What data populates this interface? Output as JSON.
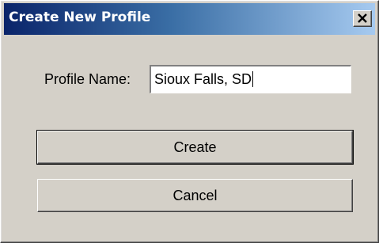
{
  "window": {
    "title": "Create New Profile"
  },
  "form": {
    "profile_name_label": "Profile Name:",
    "profile_name_value": "Sioux Falls, SD"
  },
  "buttons": {
    "create_label": "Create",
    "cancel_label": "Cancel"
  },
  "icons": {
    "close": "close-icon"
  },
  "colors": {
    "dialog_bg": "#d4d0c8",
    "title_start": "#0a246a",
    "title_end": "#a6caf0"
  }
}
